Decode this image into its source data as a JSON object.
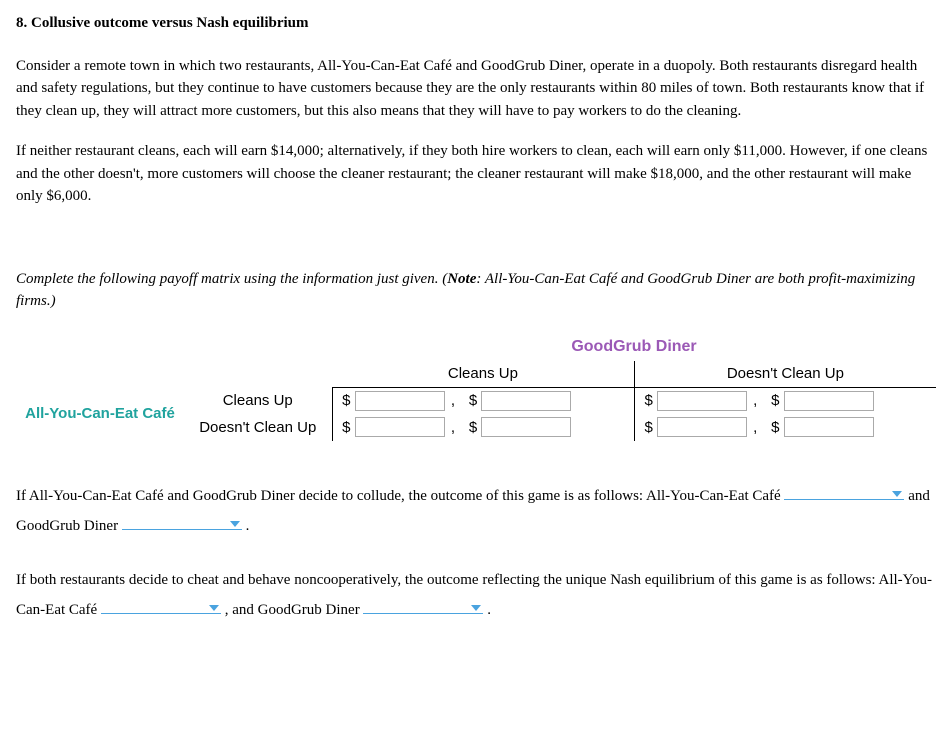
{
  "title": "8. Collusive outcome versus Nash equilibrium",
  "para1": "Consider a remote town in which two restaurants, All-You-Can-Eat Café and GoodGrub Diner, operate in a duopoly. Both restaurants disregard health and safety regulations, but they continue to have customers because they are the only restaurants within 80 miles of town. Both restaurants know that if they clean up, they will attract more customers, but this also means that they will have to pay workers to do the cleaning.",
  "para2": "If neither restaurant cleans, each will earn $14,000; alternatively, if they both hire workers to clean, each will earn only $11,000. However, if one cleans and the other doesn't, more customers will choose the cleaner restaurant; the cleaner restaurant will make $18,000, and the other restaurant will make only $6,000.",
  "instruction_pre": "Complete the following payoff matrix using the information just given. (",
  "instruction_note_label": "Note",
  "instruction_post": ": All-You-Can-Eat Café and GoodGrub Diner are both profit-maximizing firms.)",
  "matrix": {
    "col_player": "GoodGrub Diner",
    "row_player": "All-You-Can-Eat Café",
    "col_headers": [
      "Cleans Up",
      "Doesn't Clean Up"
    ],
    "row_headers": [
      "Cleans Up",
      "Doesn't Clean Up"
    ],
    "currency": "$",
    "sep": ","
  },
  "q_collude": {
    "t1": "If All-You-Can-Eat Café and GoodGrub Diner decide to collude, the outcome of this game is as follows: All-You-Can-Eat Café",
    "t2": "and GoodGrub Diner",
    "t3": "."
  },
  "q_nash": {
    "t1": "If both restaurants decide to cheat and behave noncooperatively, the outcome reflecting the unique Nash equilibrium of this game is as follows: All-You-Can-Eat Café",
    "t2": ", and GoodGrub Diner",
    "t3": "."
  }
}
